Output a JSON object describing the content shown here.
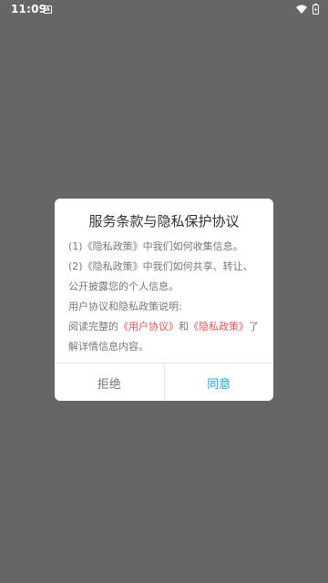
{
  "status_bar": {
    "time": "11:09",
    "app_badge": "A"
  },
  "dialog": {
    "title": "服务条款与隐私保护协议",
    "lines": [
      "(1)《隐私政策》中我们如何收集信息。",
      "(2)《隐私政策》中我们如何共享、转让、",
      "公开披露您的个人信息。",
      "用户协议和隐私政策说明:"
    ],
    "notice_prefix": "阅读完整的",
    "user_agreement_link": "《用户协议》",
    "notice_and": "和",
    "privacy_policy_link": "《隐私政策》",
    "notice_suffix_1": "了",
    "notice_suffix_2": "解详情信息内容。",
    "refuse_label": "拒绝",
    "agree_label": "同意"
  },
  "colors": {
    "overlay": "#666666",
    "link": "#e05555",
    "agree": "#1d9fe6"
  }
}
